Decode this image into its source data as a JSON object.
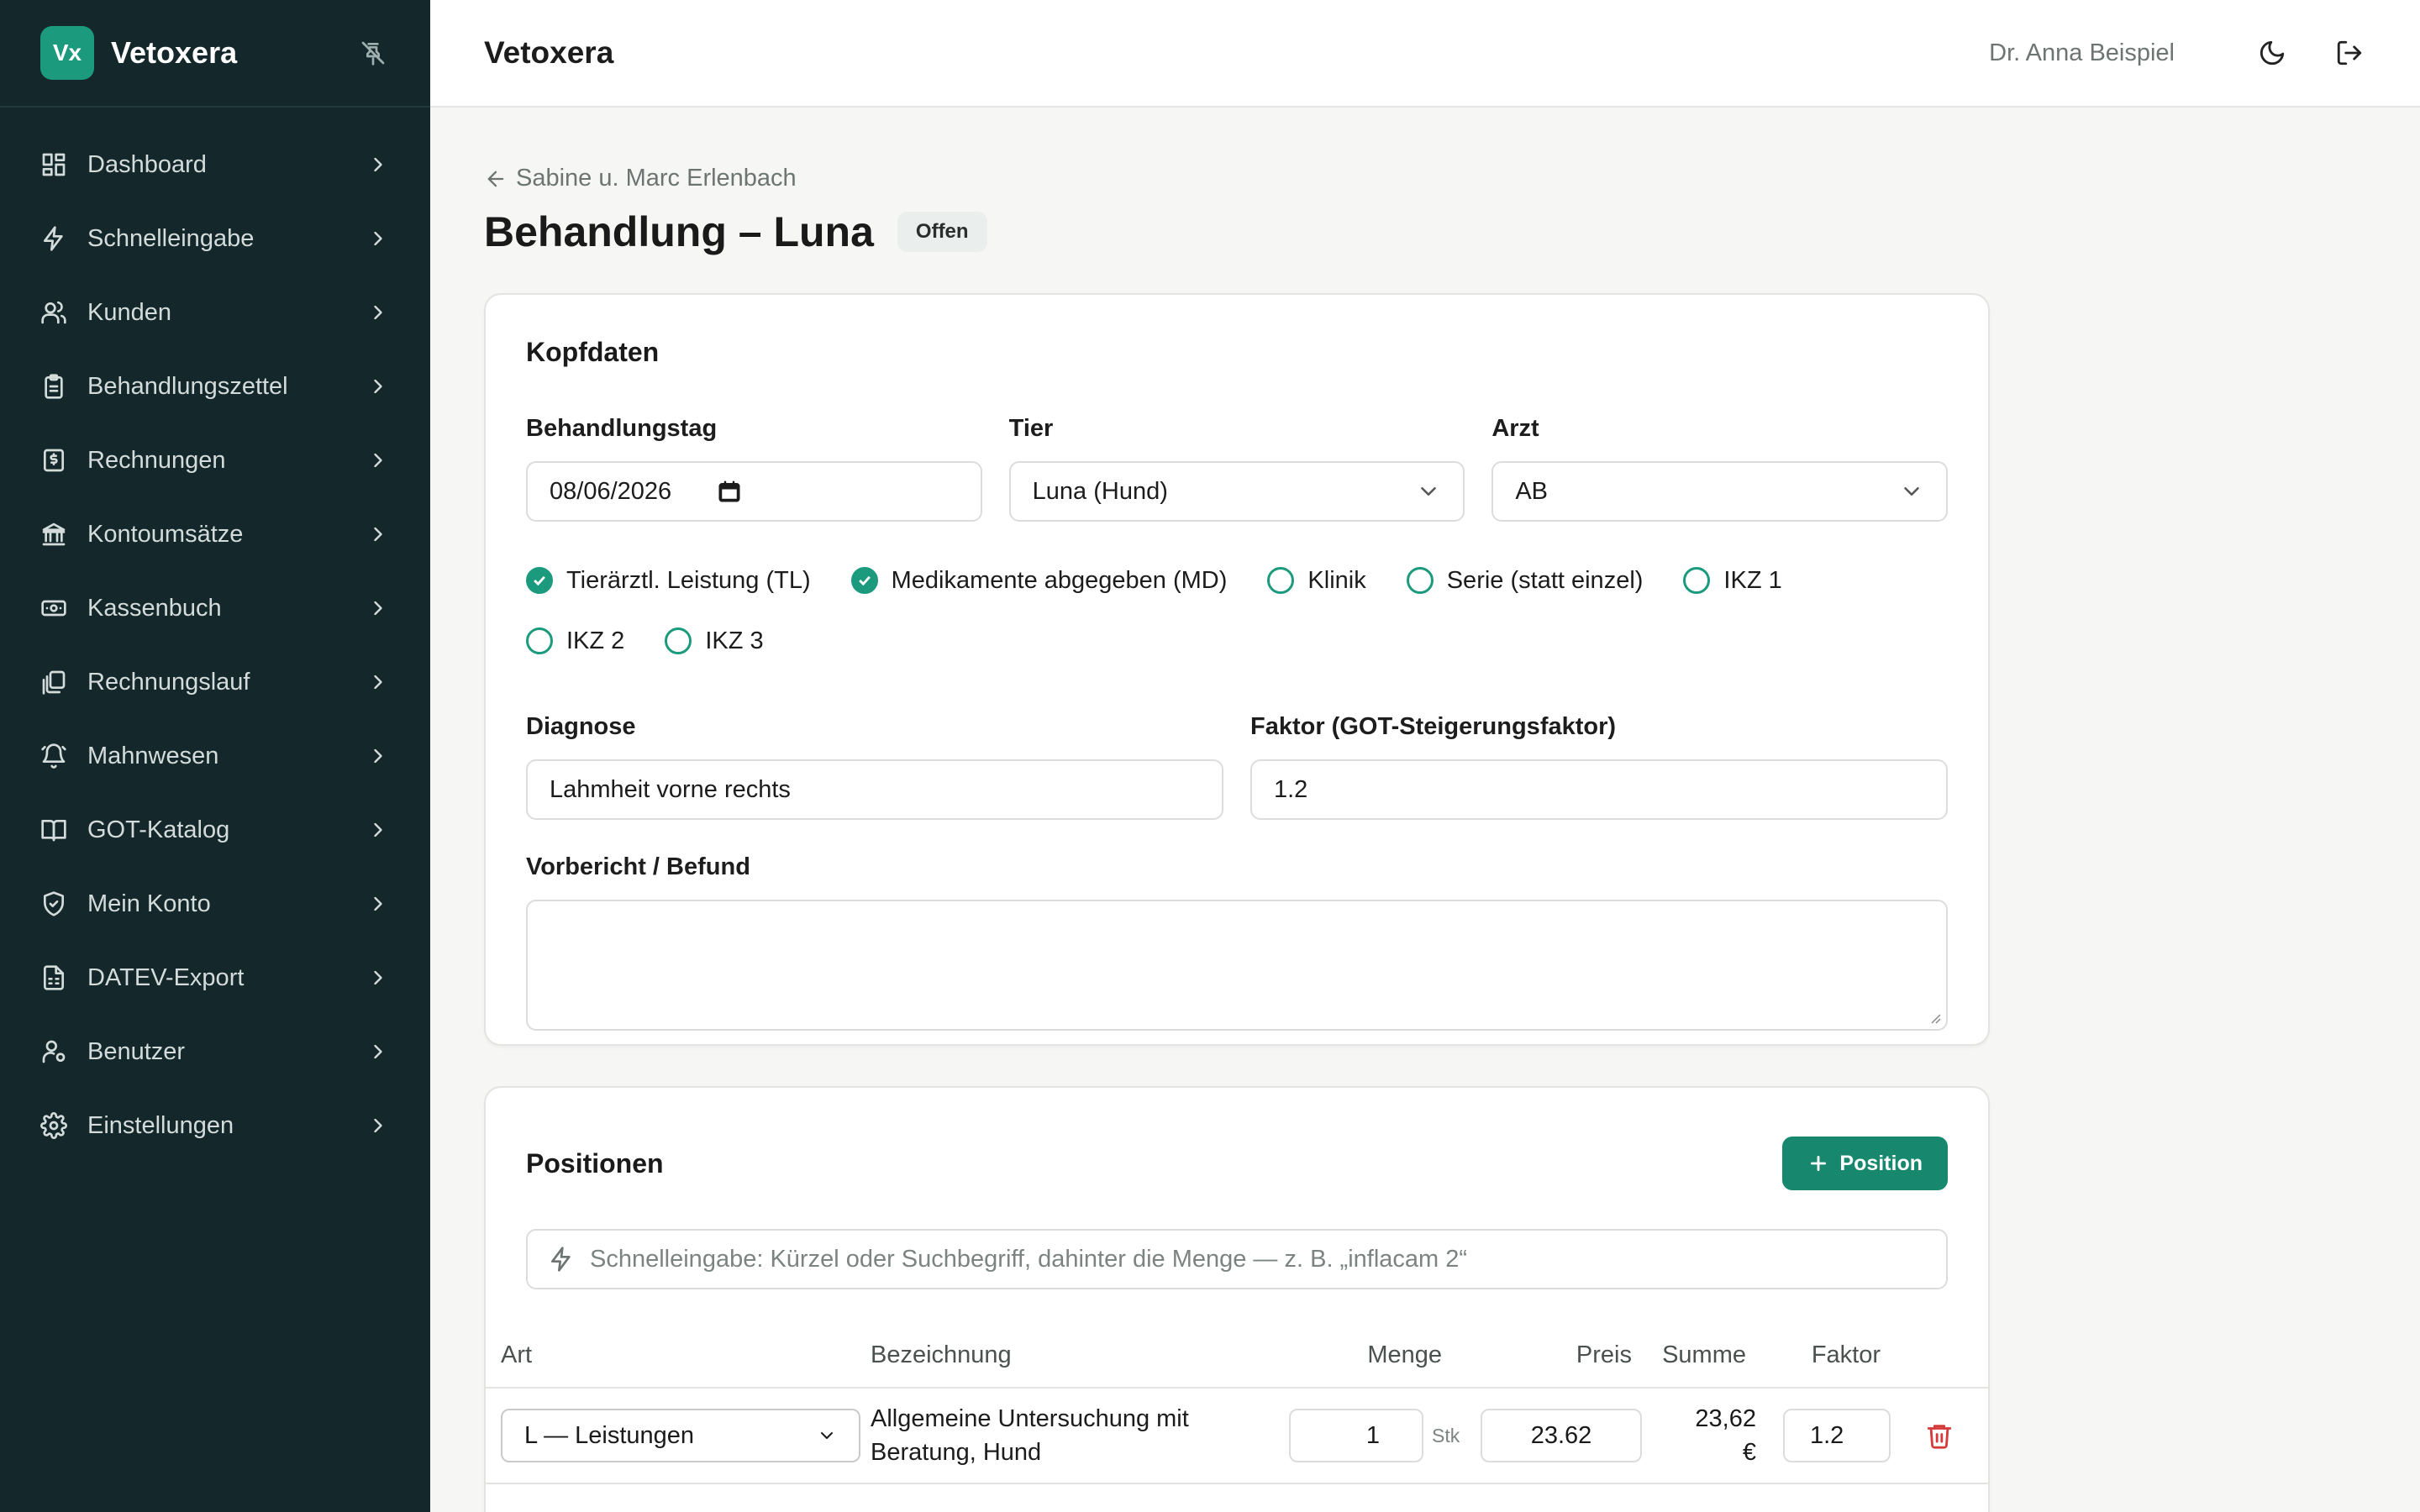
{
  "sidebar": {
    "logo": "Vx",
    "brand": "Vetoxera",
    "items": [
      {
        "label": "Dashboard"
      },
      {
        "label": "Schnelleingabe"
      },
      {
        "label": "Kunden"
      },
      {
        "label": "Behandlungszettel"
      },
      {
        "label": "Rechnungen"
      },
      {
        "label": "Kontoumsätze"
      },
      {
        "label": "Kassenbuch"
      },
      {
        "label": "Rechnungslauf"
      },
      {
        "label": "Mahnwesen"
      },
      {
        "label": "GOT-Katalog"
      },
      {
        "label": "Mein Konto"
      },
      {
        "label": "DATEV-Export"
      },
      {
        "label": "Benutzer"
      },
      {
        "label": "Einstellungen"
      }
    ]
  },
  "topbar": {
    "title": "Vetoxera",
    "user": "Dr. Anna Beispiel"
  },
  "page": {
    "breadcrumb": "Sabine u. Marc Erlenbach",
    "title": "Behandlung – Luna",
    "status": "Offen"
  },
  "kopfdaten": {
    "heading": "Kopfdaten",
    "behandlungstag_label": "Behandlungstag",
    "behandlungstag_value": "08/06/2026",
    "tier_label": "Tier",
    "tier_value": "Luna (Hund)",
    "arzt_label": "Arzt",
    "arzt_value": "AB",
    "checkboxes": [
      {
        "label": "Tierärztl. Leistung (TL)",
        "checked": true
      },
      {
        "label": "Medikamente abgegeben (MD)",
        "checked": true
      },
      {
        "label": "Klinik",
        "checked": false
      },
      {
        "label": "Serie (statt einzel)",
        "checked": false
      },
      {
        "label": "IKZ 1",
        "checked": false
      },
      {
        "label": "IKZ 2",
        "checked": false
      },
      {
        "label": "IKZ 3",
        "checked": false
      }
    ],
    "diagnose_label": "Diagnose",
    "diagnose_value": "Lahmheit vorne rechts",
    "faktor_label": "Faktor (GOT-Steigerungsfaktor)",
    "faktor_value": "1.2",
    "vorbericht_label": "Vorbericht / Befund",
    "vorbericht_value": ""
  },
  "positionen": {
    "heading": "Positionen",
    "add_button": "Position",
    "quick_placeholder": "Schnelleingabe: Kürzel oder Suchbegriff, dahinter die Menge — z. B. „inflacam 2“",
    "columns": {
      "art": "Art",
      "bezeichnung": "Bezeichnung",
      "menge": "Menge",
      "preis": "Preis",
      "summe": "Summe",
      "faktor": "Faktor"
    },
    "rows": [
      {
        "art": "L — Leistungen",
        "bezeichnung_1": "Allgemeine Untersuchung mit",
        "bezeichnung_2": "Beratung, Hund",
        "menge": "1",
        "unit": "Stk",
        "preis": "23.62",
        "summe_1": "23,62",
        "summe_2": "€",
        "faktor": "1.2"
      }
    ]
  },
  "colors": {
    "sidebar_bg": "#14272a",
    "accent": "#1c9a7d",
    "button": "#17886e",
    "danger": "#d63b3b"
  }
}
